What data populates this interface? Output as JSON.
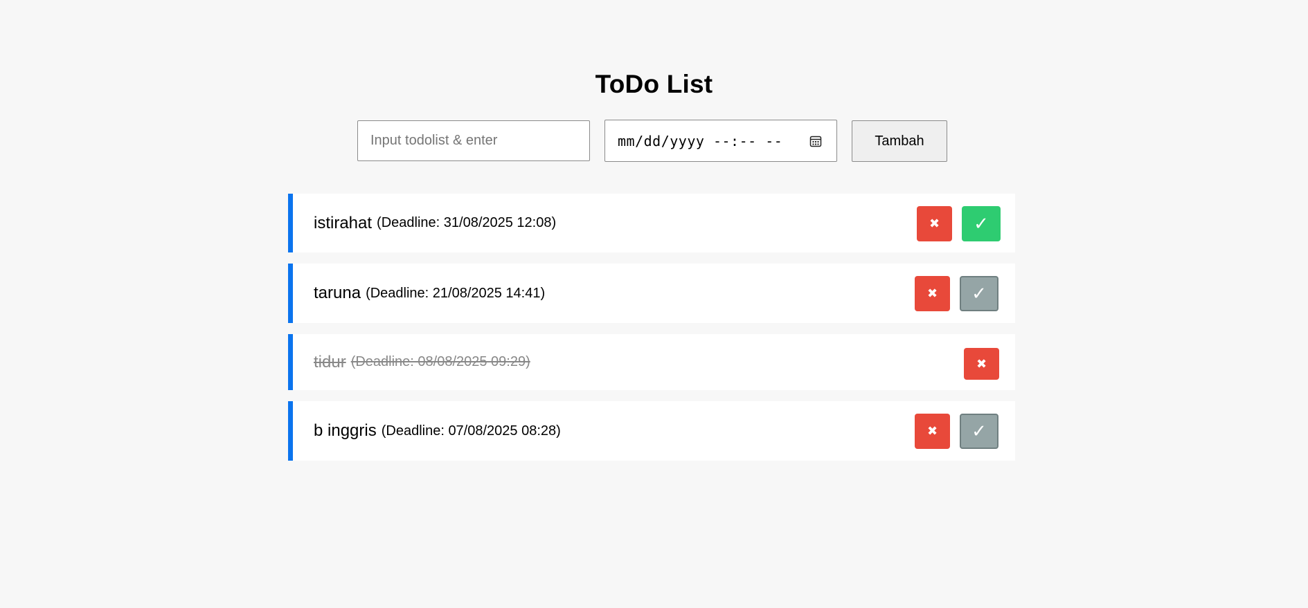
{
  "header": {
    "title": "ToDo List"
  },
  "form": {
    "todo_placeholder": "Input todolist & enter",
    "todo_value": "",
    "datetime_placeholder": "mm/dd/yyyy --:-- --",
    "add_label": "Tambah"
  },
  "todos": [
    {
      "name": "istirahat",
      "deadline": "(Deadline: 31/08/2025 12:08)",
      "completed": false,
      "delete_label": "✖",
      "check_label": "✓",
      "check_state": "active"
    },
    {
      "name": "taruna",
      "deadline": "(Deadline: 21/08/2025 14:41)",
      "completed": false,
      "delete_label": "✖",
      "check_label": "✓",
      "check_state": "inactive"
    },
    {
      "name": "tidur",
      "deadline": "(Deadline: 08/08/2025 09:29)",
      "completed": true,
      "delete_label": "✖"
    },
    {
      "name": "b inggris",
      "deadline": "(Deadline: 07/08/2025 08:28)",
      "completed": false,
      "delete_label": "✖",
      "check_label": "✓",
      "check_state": "inactive"
    }
  ],
  "colors": {
    "background": "#f7f7f7",
    "accent_border": "#0b74ee",
    "delete": "#e8493a",
    "check_active": "#2ecc71",
    "check_inactive": "#95a5a6",
    "completed_text": "#888888"
  },
  "icons": {
    "date_picker": "calendar-icon"
  }
}
